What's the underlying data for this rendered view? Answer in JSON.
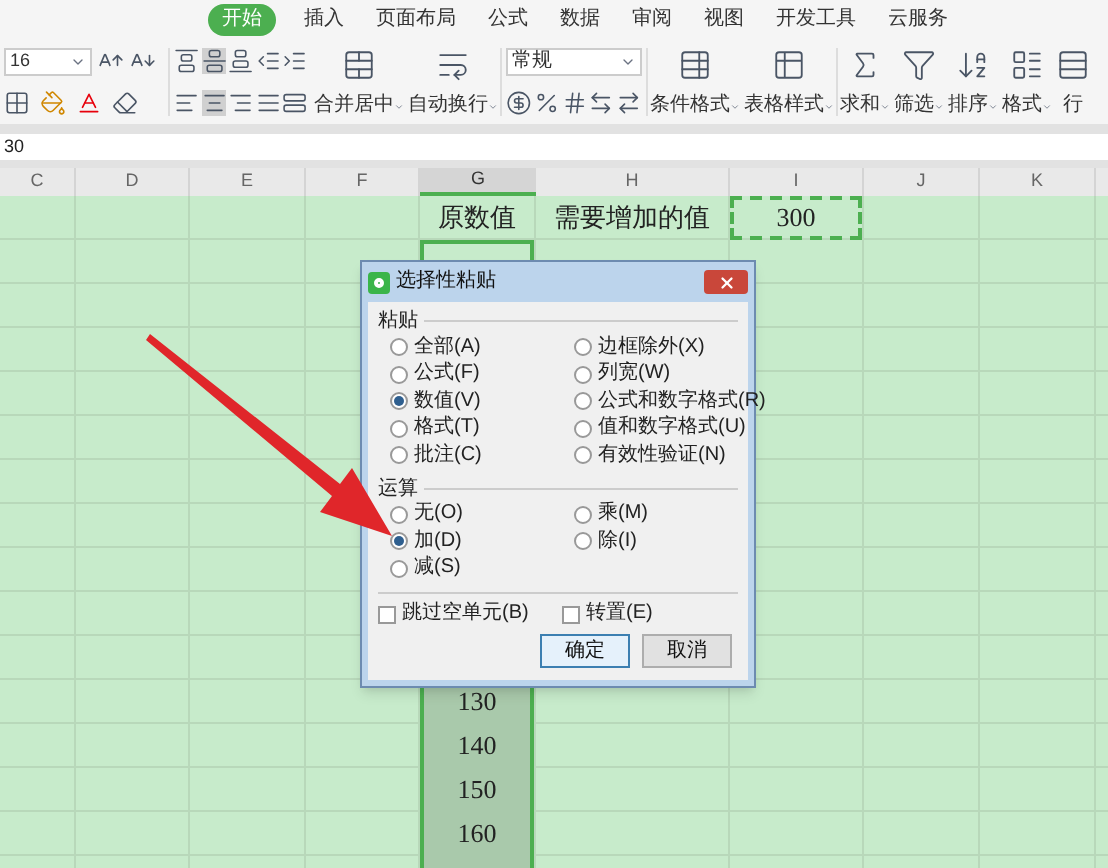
{
  "ribbon_tabs": [
    {
      "label": "开始",
      "selected": true
    },
    {
      "label": "插入",
      "selected": false
    },
    {
      "label": "页面布局",
      "selected": false
    },
    {
      "label": "公式",
      "selected": false
    },
    {
      "label": "数据",
      "selected": false
    },
    {
      "label": "审阅",
      "selected": false
    },
    {
      "label": "视图",
      "selected": false
    },
    {
      "label": "开发工具",
      "selected": false
    },
    {
      "label": "云服务",
      "selected": false
    }
  ],
  "toolbar": {
    "font_size": "16",
    "number_format": "常规",
    "large_buttons": [
      {
        "label": "合并居中"
      },
      {
        "label": "自动换行"
      },
      {
        "label": "条件格式"
      },
      {
        "label": "表格样式"
      },
      {
        "label": "求和"
      },
      {
        "label": "筛选"
      },
      {
        "label": "排序"
      },
      {
        "label": "格式"
      },
      {
        "label": "行"
      }
    ]
  },
  "formula_bar": {
    "value": "30"
  },
  "sheet": {
    "columns": [
      {
        "label": "C",
        "selected": false
      },
      {
        "label": "D",
        "selected": false
      },
      {
        "label": "E",
        "selected": false
      },
      {
        "label": "F",
        "selected": false
      },
      {
        "label": "G",
        "selected": true
      },
      {
        "label": "H",
        "selected": false
      },
      {
        "label": "I",
        "selected": false
      },
      {
        "label": "J",
        "selected": false
      },
      {
        "label": "K",
        "selected": false
      }
    ],
    "header_row": {
      "g": "原数值",
      "h": "需要增加的值",
      "i": "300"
    },
    "selected_values": [
      "130",
      "140",
      "150",
      "160"
    ]
  },
  "dialog": {
    "title": "选择性粘贴",
    "sections": [
      {
        "label": "粘贴",
        "options": [
          {
            "label": "全部(A)",
            "selected": false
          },
          {
            "label": "边框除外(X)",
            "selected": false
          },
          {
            "label": "公式(F)",
            "selected": false
          },
          {
            "label": "列宽(W)",
            "selected": false
          },
          {
            "label": "数值(V)",
            "selected": true
          },
          {
            "label": "公式和数字格式(R)",
            "selected": false
          },
          {
            "label": "格式(T)",
            "selected": false
          },
          {
            "label": "值和数字格式(U)",
            "selected": false
          },
          {
            "label": "批注(C)",
            "selected": false
          },
          {
            "label": "有效性验证(N)",
            "selected": false
          }
        ]
      },
      {
        "label": "运算",
        "options": [
          {
            "label": "无(O)",
            "selected": false
          },
          {
            "label": "乘(M)",
            "selected": false
          },
          {
            "label": "加(D)",
            "selected": true
          },
          {
            "label": "除(I)",
            "selected": false
          },
          {
            "label": "减(S)",
            "selected": false
          }
        ]
      }
    ],
    "checkboxes": [
      {
        "label": "跳过空单元(B)",
        "checked": false
      },
      {
        "label": "转置(E)",
        "checked": false
      }
    ],
    "buttons": [
      {
        "label": "确定",
        "kind": "primary"
      },
      {
        "label": "取消",
        "kind": "normal"
      }
    ]
  }
}
